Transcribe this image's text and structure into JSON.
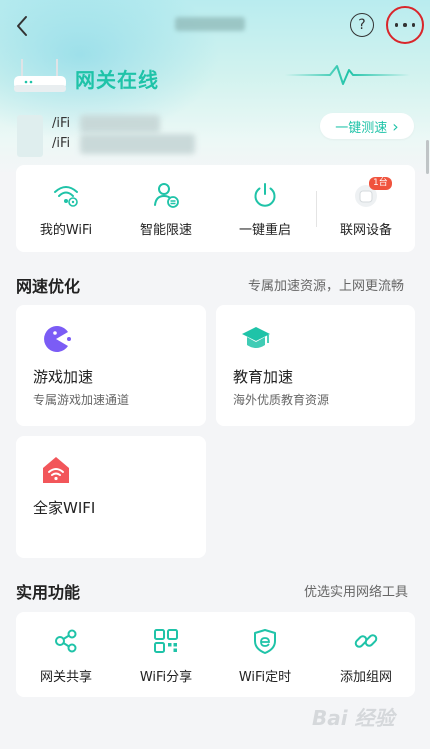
{
  "header": {
    "back_icon": "chevron-left-icon",
    "help_label": "?",
    "more_icon": "more-dots-icon",
    "status_text": "网关在线",
    "accent_color": "#1fc3a8",
    "highlight_color": "#d9262b"
  },
  "wifi": {
    "line1_prefix": "/iFi",
    "line2_prefix": "/iFi"
  },
  "speedtest": {
    "label": "一键测速",
    "arrow": "›"
  },
  "quick_actions": [
    {
      "label": "我的WiFi",
      "icon": "wifi-settings-icon"
    },
    {
      "label": "智能限速",
      "icon": "user-speed-limit-icon"
    },
    {
      "label": "一键重启",
      "icon": "power-icon"
    },
    {
      "label": "联网设备",
      "icon": "device-icon",
      "badge": "1台"
    }
  ],
  "speed_section": {
    "title": "网速优化",
    "subtitle": "专属加速资源，上网更流畅",
    "items": [
      {
        "title": "游戏加速",
        "desc": "专属游戏加速通道",
        "icon": "game-pacman-icon",
        "color": "#7b5cf5"
      },
      {
        "title": "教育加速",
        "desc": "海外优质教育资源",
        "icon": "graduation-cap-icon",
        "color": "#1fc3a8"
      },
      {
        "title": "全家WIFI",
        "desc": "",
        "icon": "home-wifi-icon",
        "color": "#f2565a"
      }
    ]
  },
  "tools_section": {
    "title": "实用功能",
    "subtitle": "优选实用网络工具",
    "items": [
      {
        "label": "网关共享",
        "icon": "share-icon"
      },
      {
        "label": "WiFi分享",
        "icon": "qr-code-icon"
      },
      {
        "label": "WiFi定时",
        "icon": "shield-timer-icon"
      },
      {
        "label": "添加组网",
        "icon": "link-icon"
      }
    ]
  },
  "watermark": {
    "text": "Bai 经验"
  }
}
